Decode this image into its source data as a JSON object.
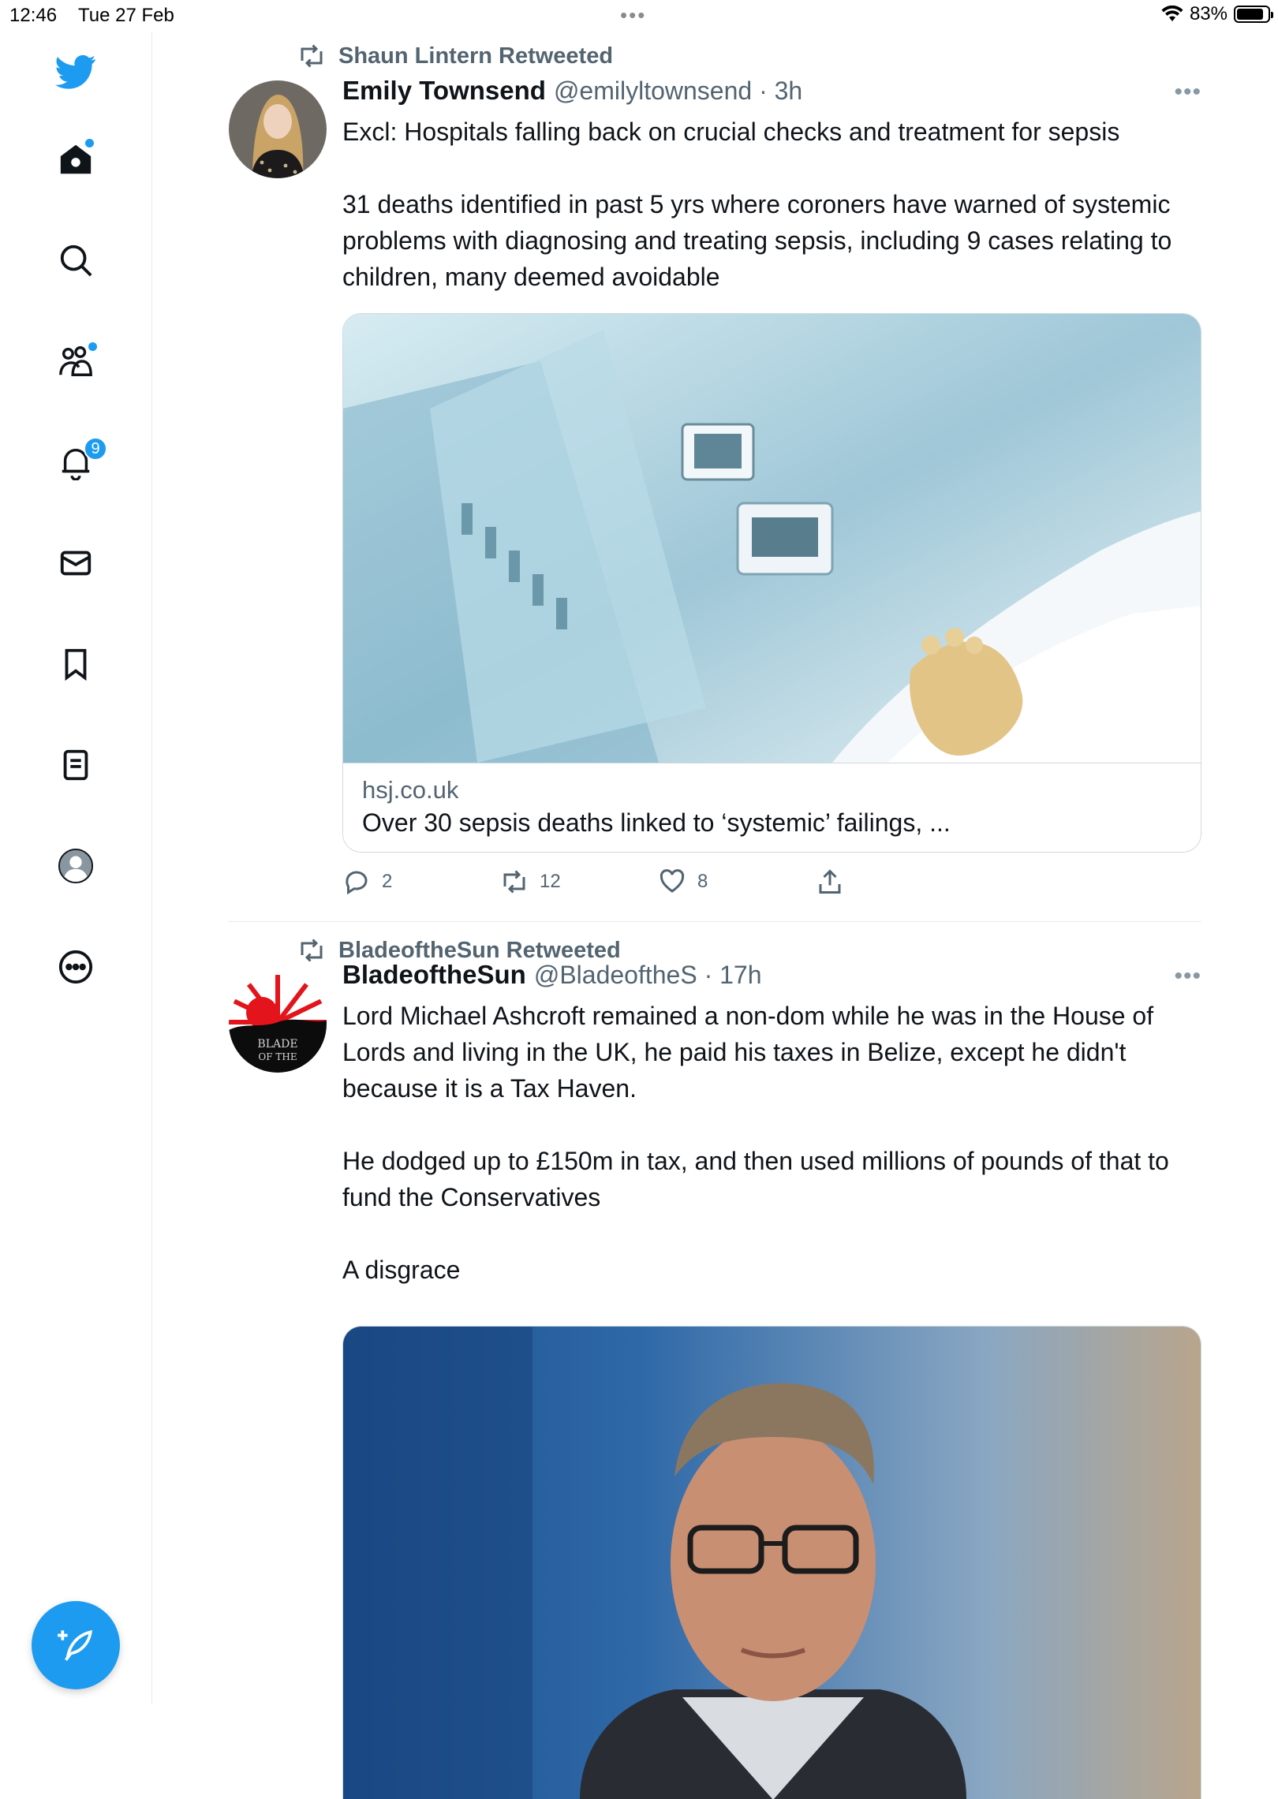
{
  "status_bar": {
    "time": "12:46",
    "date": "Tue 27 Feb",
    "battery": "83%"
  },
  "sidebar": {
    "items": [
      {
        "name": "twitter-logo"
      },
      {
        "name": "home"
      },
      {
        "name": "explore"
      },
      {
        "name": "communities"
      },
      {
        "name": "notifications",
        "badge": "9"
      },
      {
        "name": "messages"
      },
      {
        "name": "bookmarks"
      },
      {
        "name": "lists"
      },
      {
        "name": "profile"
      },
      {
        "name": "more"
      }
    ],
    "accent_color": "#1d9bf0"
  },
  "tweets": [
    {
      "retweeted_by": "Shaun Lintern Retweeted",
      "name": "Emily Townsend",
      "handle": "@emilyltownsend · 3h",
      "text": "Excl: Hospitals falling back on crucial checks and treatment for sepsis\n\n31 deaths identified in past 5 yrs where coroners have warned of systemic problems with diagnosing and treating sepsis, including 9 cases relating to children, many deemed avoidable",
      "card": {
        "domain": "hsj.co.uk",
        "title": "Over 30 sepsis deaths linked to ‘systemic’ failings, ..."
      },
      "actions": {
        "replies": "2",
        "retweets": "12",
        "likes": "8"
      }
    },
    {
      "retweeted_by": "BladeoftheSun Retweeted",
      "name": "BladeoftheSun",
      "handle": "@BladeoftheS · 17h",
      "text": "Lord Michael Ashcroft remained a non-dom while he was in the House of Lords and living in the UK, he paid his taxes in Belize, except he didn't because it is a Tax Haven.\n\nHe dodged up to £150m in tax, and then used millions of pounds of that to fund the Conservatives\n\nA disgrace",
      "avatar_text": "BLADE OF THE"
    }
  ]
}
